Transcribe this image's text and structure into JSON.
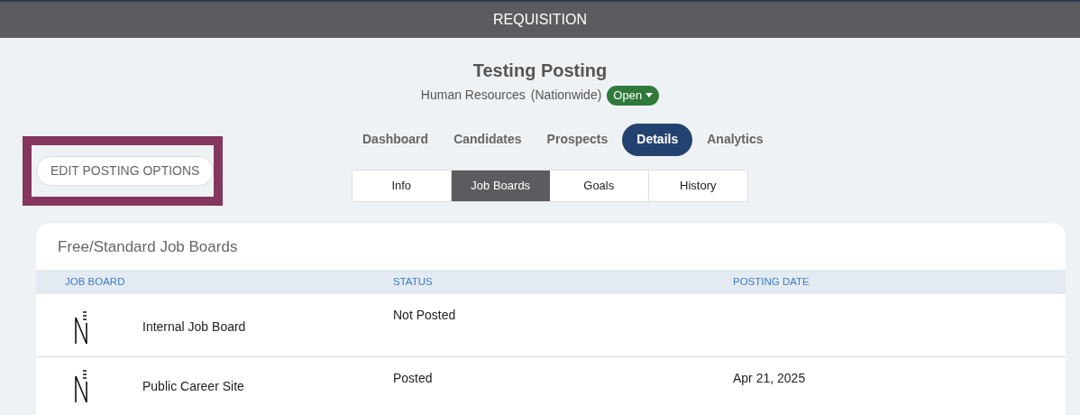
{
  "header": {
    "title": "REQUISITION"
  },
  "posting": {
    "title": "Testing Posting",
    "department": "Human Resources",
    "location": "(Nationwide)",
    "status": "Open"
  },
  "tabs": [
    {
      "label": "Dashboard",
      "selected": false
    },
    {
      "label": "Candidates",
      "selected": false
    },
    {
      "label": "Prospects",
      "selected": false
    },
    {
      "label": "Details",
      "selected": true
    },
    {
      "label": "Analytics",
      "selected": false
    }
  ],
  "edit_button": {
    "label": "EDIT POSTING OPTIONS",
    "highlighted": true
  },
  "subtabs": [
    {
      "label": "Info",
      "selected": false
    },
    {
      "label": "Job Boards",
      "selected": true
    },
    {
      "label": "Goals",
      "selected": false
    },
    {
      "label": "History",
      "selected": false
    }
  ],
  "card": {
    "title": "Free/Standard Job Boards",
    "columns": [
      "JOB BOARD",
      "STATUS",
      "POSTING DATE"
    ],
    "rows": [
      {
        "name": "Internal Job Board",
        "status": "Not Posted"
      },
      {
        "name": "Public Career Site",
        "status": "Posted",
        "posting_date": "Apr 21, 2025"
      }
    ]
  }
}
